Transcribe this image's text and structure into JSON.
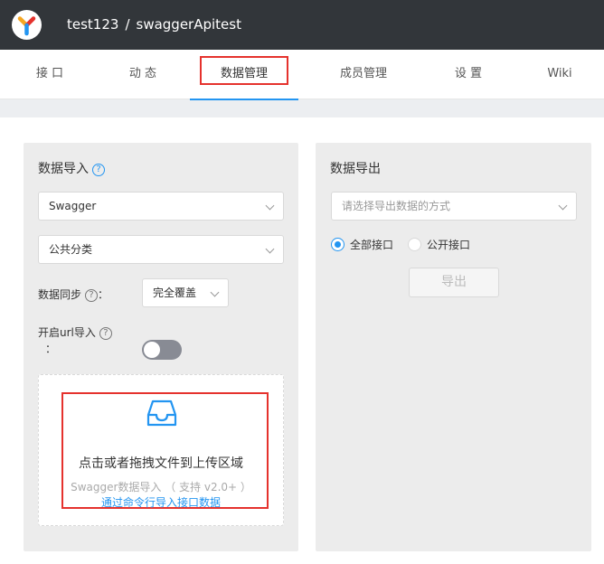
{
  "header": {
    "project_group": "test123",
    "separator": "/",
    "project_name": "swaggerApitest"
  },
  "tabs": [
    {
      "label": "接 口"
    },
    {
      "label": "动 态"
    },
    {
      "label": "数据管理",
      "active": true
    },
    {
      "label": "成员管理"
    },
    {
      "label": "设 置"
    },
    {
      "label": "Wiki"
    }
  ],
  "import_panel": {
    "title": "数据导入",
    "help_icon": "question-circle-icon",
    "format_select": "Swagger",
    "category_select": "公共分类",
    "sync_label": "数据同步",
    "sync_colon": "：",
    "sync_select": "完全覆盖",
    "url_import_label": "开启url导入",
    "url_import_colon": "：",
    "url_import_enabled": false,
    "upload": {
      "icon": "inbox-icon",
      "main_text": "点击或者拖拽文件到上传区域",
      "hint_text": "Swagger数据导入 （ 支持 v2.0+ ）",
      "link_text": "通过命令行导入接口数据"
    }
  },
  "export_panel": {
    "title": "数据导出",
    "method_select_placeholder": "请选择导出数据的方式",
    "radio_all": "全部接口",
    "radio_public": "公开接口",
    "selected_radio": "全部接口",
    "export_button": "导出"
  },
  "colors": {
    "topbar": "#32363a",
    "accent": "#2395f1",
    "highlight_box": "#e5322d"
  }
}
